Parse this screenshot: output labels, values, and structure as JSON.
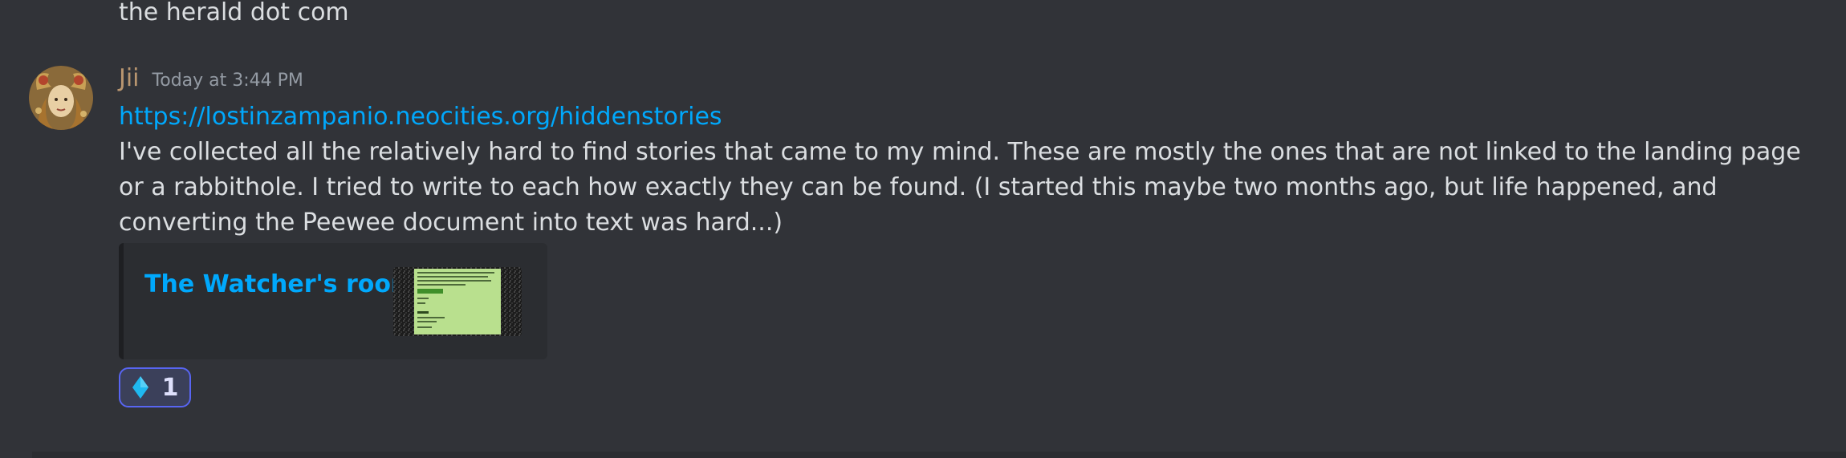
{
  "previous_message": {
    "text": "the herald dot com"
  },
  "message": {
    "author": "Jii",
    "author_color": "#b99670",
    "timestamp": "Today at 3:44 PM",
    "link": "https://lostinzampanio.neocities.org/hiddenstories",
    "body": "I've collected all the relatively hard to find stories that came to my mind. These are mostly the ones that are not linked to the landing page or a rabbithole. I tried to write to each how exactly they can be found. (I started this maybe two months ago, but life happened, and converting the Peewee document into text was hard...)",
    "embed": {
      "title": "The Watcher's room",
      "thumbnail_icon": "webpage-thumbnail"
    },
    "reaction": {
      "emoji_icon": "blue-diamond-icon",
      "count": "1"
    }
  },
  "colors": {
    "background": "#313338",
    "link": "#00a8fc",
    "reaction_border": "#5865f2"
  }
}
